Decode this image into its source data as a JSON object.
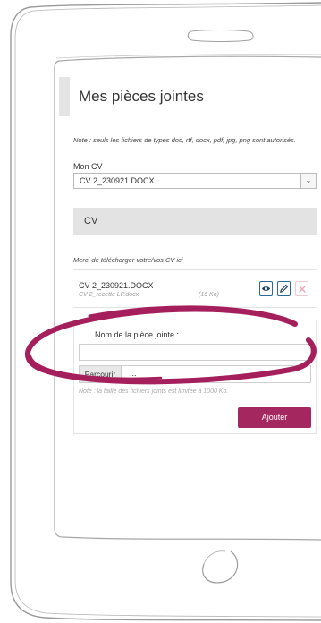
{
  "page": {
    "title": "Mes pièces jointes",
    "note": "Note : seuls les fichiers de types doc, rtf, docx, pdf, jpg, png sont autorisés."
  },
  "cv_select": {
    "label": "Mon CV",
    "value": "CV 2_230921.DOCX",
    "icon": "chevron-down-icon"
  },
  "cv_section": {
    "title": "CV",
    "help": "Merci de télécharger votre/vos CV ici"
  },
  "attached_file": {
    "name": "CV 2_230921.DOCX",
    "original_name": "CV 2_recette LP.docx",
    "size": "(16 Ko)",
    "icons": [
      "eye-icon",
      "pencil-icon",
      "close-icon"
    ]
  },
  "upload": {
    "piece_label": "Nom de la pièce jointe :",
    "browse_label": "Parcourir",
    "file_placeholder": "...",
    "limit_note": "Note : la taille des fichiers joints est limitée à 1000 Ko.",
    "add_button": "Ajouter"
  },
  "colors": {
    "accent": "#a4275f",
    "annotation": "#a51f5c",
    "icon_blue": "#1e3f66"
  }
}
